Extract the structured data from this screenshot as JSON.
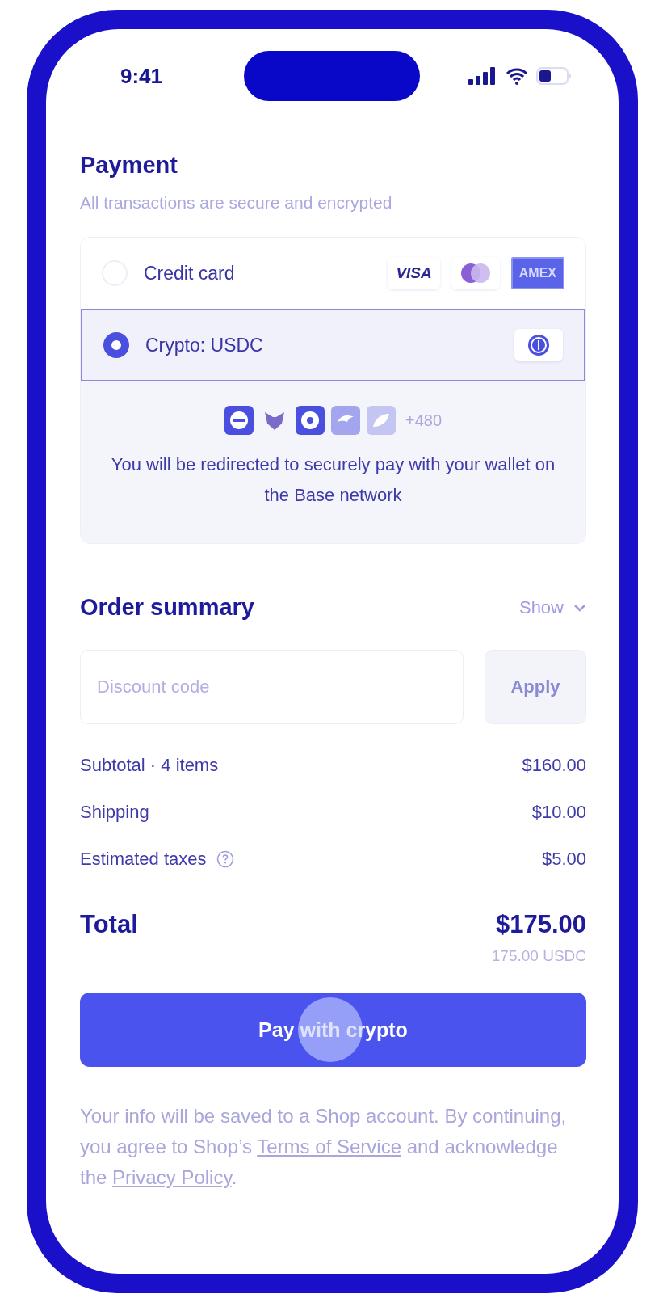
{
  "status_bar": {
    "time": "9:41"
  },
  "payment": {
    "title": "Payment",
    "subtitle": "All transactions are secure and encrypted",
    "methods": [
      {
        "label": "Credit card",
        "selected": false,
        "brands": [
          {
            "kind": "wordmark",
            "label": "VISA"
          },
          {
            "kind": "circles"
          },
          {
            "kind": "badge",
            "label": "AMEX"
          }
        ]
      },
      {
        "label": "Crypto: USDC",
        "selected": true,
        "brands": [
          {
            "kind": "coin"
          }
        ]
      }
    ],
    "wallet_panel": {
      "more_count": "+480",
      "message": "You will be redirected to securely pay with your wallet on the Base network"
    }
  },
  "order_summary": {
    "title": "Order summary",
    "toggle": "Show",
    "discount": {
      "placeholder": "Discount code",
      "button": "Apply"
    },
    "lines": [
      {
        "label": "Subtotal · 4 items",
        "value": "$160.00",
        "info": false
      },
      {
        "label": "Shipping",
        "value": "$10.00",
        "info": false
      },
      {
        "label": "Estimated taxes",
        "value": "$5.00",
        "info": true
      }
    ],
    "total": {
      "label": "Total",
      "value": "$175.00",
      "converted": "175.00 USDC"
    }
  },
  "pay_button": "Pay with crypto",
  "disclaimer": [
    {
      "kind": "text",
      "text": "Your info will be saved to a Shop account. By continuing, you agree to Shop’s "
    },
    {
      "kind": "link",
      "text": "Terms of Service"
    },
    {
      "kind": "text",
      "text": " and acknowledge the "
    },
    {
      "kind": "link",
      "text": "Privacy Policy"
    },
    {
      "kind": "text",
      "text": "."
    }
  ]
}
